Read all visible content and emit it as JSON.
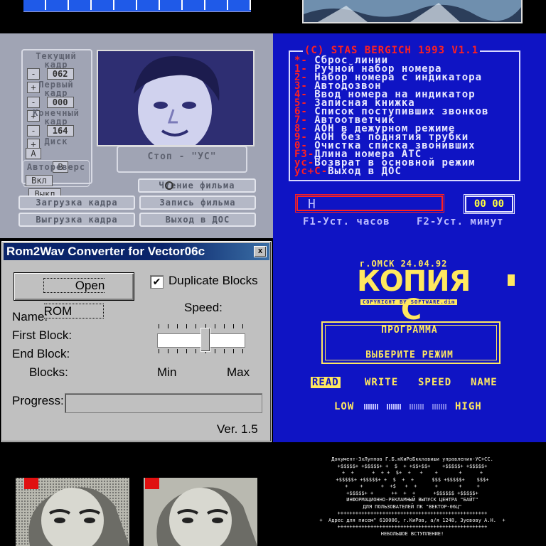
{
  "film": {
    "current_label": [
      "Текущий",
      "кадр"
    ],
    "current_value": "062",
    "first_label": [
      "Первый",
      "кадр"
    ],
    "first_value": "000",
    "end_label": [
      "Конечный",
      "кадр"
    ],
    "end_value": "164",
    "minus": "-",
    "plus": "+",
    "disk_label": "Диск",
    "disk_a": "A",
    "disk_b": "B",
    "autoreverse_label": "Автореверс",
    "on": "Вкл",
    "off": "Выкл",
    "status": "Стоп - \"УС\"",
    "btn_read_film": "Чтение фильма",
    "btn_load_frame": "Загрузка кадра",
    "btn_write_film": "Запись фильма",
    "btn_unload_frame": "Выгрузка кадра",
    "btn_exit_dos": "Выход в ДОС"
  },
  "aon": {
    "title": "(C) STAS BERGICH  1993  V1.1",
    "items": [
      {
        "key": "*-",
        "text": " Сброс линии"
      },
      {
        "key": "1-",
        "text": " Ручной набор номера"
      },
      {
        "key": "2-",
        "text": " Набор номера с индикатора"
      },
      {
        "key": "3-",
        "text": " Автодозвон"
      },
      {
        "key": "4-",
        "text": " Ввод номера на индикатор"
      },
      {
        "key": "5-",
        "text": " Записная книжка"
      },
      {
        "key": "6-",
        "text": " Список поступивших звонков"
      },
      {
        "key": "7-",
        "text": " Автоответчик"
      },
      {
        "key": "8-",
        "text": " АОН в дежурном режиме"
      },
      {
        "key": "9-",
        "text": " АОН без поднятия трубки"
      },
      {
        "key": "0-",
        "text": " Очистка списка звонивших"
      },
      {
        "key": "F3-",
        "text": "Длина номера АТС"
      },
      {
        "key": "ус-",
        "text": "Возврат в основной режим"
      },
      {
        "key": "ус+С-",
        "text": "Выход в ДОС"
      }
    ],
    "input_value": "H",
    "clock": "00 00",
    "f1_label": "F1-Уст. часов",
    "f2_label": "F2-Уст. минут"
  },
  "dialog": {
    "title": "Rom2Wav Converter for Vector06c",
    "close": "x",
    "open_rom": "Open ROM",
    "duplicate_blocks": "Duplicate Blocks",
    "duplicate_checked": "✔",
    "speed_label": "Speed:",
    "name_label": "Name:",
    "first_block_label": "First Block:",
    "end_block_label": "End Block:",
    "blocks_label": "Blocks:",
    "min_label": "Min",
    "max_label": "Max",
    "progress_label": "Progress:",
    "version": "Ver. 1.5",
    "speed_level": 0.5
  },
  "kopia": {
    "city_date": "г.ОМСК 24.04.92",
    "title": "КОПИЯ С",
    "copyright": "COPYRIGHT BY SOFTWARE.dim",
    "program_label": "ПРОГРАММА",
    "choose_mode": "ВЫБЕРИТЕ РЕЖИМ",
    "modes": [
      "READ",
      "WRITE",
      "SPEED",
      "NAME"
    ],
    "selected_mode": "READ",
    "low": "LOW",
    "high": "HIGH"
  },
  "document": {
    "lines": [
      "Документ-3хЛуппов Г.Б.кКиРоБкклавиши управления-УС+СС.",
      "+$$$$$+ +$$$$$+ +  $  + +$$+$$+    +$$$$$+ +$$$$$+",
      "+  +      +  + +  $+  +   +    +       +      +",
      "+$$$$$+ +$$$$$+ +  $  +  +      $$$ +$$$$$+    $$$+",
      "+    +      +  +$   +  +      +       +     +",
      "+$$$$$+ +      ++  +  +      +$$$$$$ +$$$$$+",
      "ИНФОРМАЦИОННО-РЕКЛАМНЫЙ ВЫПУСК ЦЕНТРА \"БАЙТ\"",
      "ДЛЯ ПОЛЬЗОВАТЕЛЕЙ ПК \"ВЕКТОР-06Ц\"",
      "++++++++++++++++++++++++++++++++++++++++++++++++++",
      "+  Адрес для писем\" 610006, г.КиРов, а/я 1248, Зуевову А.Н.  +",
      "++++++++++++++++++++++++++++++++++++++++++++++++++",
      "НЕБОЛЬШОЕ ВСТУПЛЕНИЕ!"
    ]
  }
}
